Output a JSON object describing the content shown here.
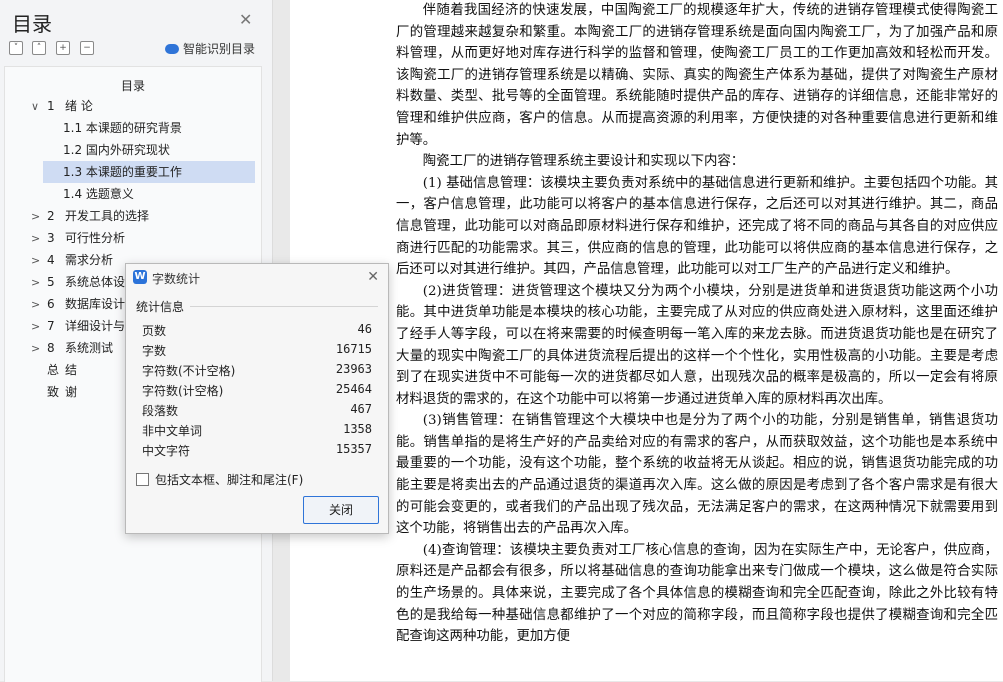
{
  "toc": {
    "title": "目录",
    "heading": "目录",
    "smart_label": "智能识别目录",
    "tool_icons": [
      "collapse-all-icon",
      "expand-all-icon",
      "add-icon",
      "remove-icon"
    ],
    "items": [
      {
        "arrow": "∨",
        "num": "1",
        "text": "绪  论",
        "level": 0
      },
      {
        "arrow": "",
        "num": "",
        "text": "1.1 本课题的研究背景",
        "level": 1
      },
      {
        "arrow": "",
        "num": "",
        "text": "1.2 国内外研究现状",
        "level": 1
      },
      {
        "arrow": "",
        "num": "",
        "text": "1.3 本课题的重要工作",
        "level": 1,
        "active": true
      },
      {
        "arrow": "",
        "num": "",
        "text": "1.4 选题意义",
        "level": 1
      },
      {
        "arrow": ">",
        "num": "2",
        "text": "开发工具的选择",
        "level": 0
      },
      {
        "arrow": ">",
        "num": "3",
        "text": "可行性分析",
        "level": 0
      },
      {
        "arrow": ">",
        "num": "4",
        "text": "需求分析",
        "level": 0
      },
      {
        "arrow": ">",
        "num": "5",
        "text": "系统总体设",
        "level": 0
      },
      {
        "arrow": ">",
        "num": "6",
        "text": "数据库设计",
        "level": 0
      },
      {
        "arrow": ">",
        "num": "7",
        "text": "详细设计与",
        "level": 0
      },
      {
        "arrow": ">",
        "num": "8",
        "text": "系统测试",
        "level": 0
      },
      {
        "arrow": "",
        "num": "总",
        "text": "结",
        "level": 0
      },
      {
        "arrow": "",
        "num": "致",
        "text": "谢",
        "level": 0
      }
    ]
  },
  "dialog": {
    "title": "字数统计",
    "group_label": "统计信息",
    "stats": [
      {
        "label": "页数",
        "value": "46"
      },
      {
        "label": "字数",
        "value": "16715"
      },
      {
        "label": "字符数(不计空格)",
        "value": "23963"
      },
      {
        "label": "字符数(计空格)",
        "value": "25464"
      },
      {
        "label": "段落数",
        "value": "467"
      },
      {
        "label": "非中文单词",
        "value": "1358"
      },
      {
        "label": "中文字符",
        "value": "15357"
      }
    ],
    "checkbox_label": "包括文本框、脚注和尾注(F)",
    "checkbox_checked": false,
    "close_button": "关闭"
  },
  "document": {
    "paragraphs": [
      "伴随着我国经济的快速发展，中国陶瓷工厂的规模逐年扩大，传统的进销存管理模式使得陶瓷工厂的管理越来越复杂和繁重。本陶瓷工厂的进销存管理系统是面向国内陶瓷工厂，为了加强产品和原料管理，从而更好地对库存进行科学的监督和管理，使陶瓷工厂员工的工作更加高效和轻松而开发。该陶瓷工厂的进销存管理系统是以精确、实际、真实的陶瓷生产体系为基础，提供了对陶瓷生产原材料数量、类型、批号等的全面管理。系统能随时提供产品的库存、进销存的详细信息，还能非常好的管理和维护供应商，客户的信息。从而提高资源的利用率，方便快捷的对各种重要信息进行更新和维护等。",
      "陶瓷工厂的进销存管理系统主要设计和实现以下内容：",
      "(1) 基础信息管理：该模块主要负责对系统中的基础信息进行更新和维护。主要包括四个功能。其一，客户信息管理，此功能可以将客户的基本信息进行保存，之后还可以对其进行维护。其二，商品信息管理，此功能可以对商品即原材料进行保存和维护，还完成了将不同的商品与其各自的对应供应商进行匹配的功能需求。其三，供应商的信息的管理，此功能可以将供应商的基本信息进行保存，之后还可以对其进行维护。其四，产品信息管理，此功能可以对工厂生产的产品进行定义和维护。",
      "(2)进货管理：进货管理这个模块又分为两个小模块，分别是进货单和进货退货功能这两个小功能。其中进货单功能是本模块的核心功能，主要完成了从对应的供应商处进入原材料，这里面还维护了经手人等字段，可以在将来需要的时候查明每一笔入库的来龙去脉。而进货退货功能也是在研究了大量的现实中陶瓷工厂的具体进货流程后提出的这样一个个性化，实用性极高的小功能。主要是考虑到了在现实进货中不可能每一次的进货都尽如人意，出现残次品的概率是极高的，所以一定会有将原材料退货的需求的，在这个功能中可以将第一步通过进货单入库的原材料再次出库。",
      "(3)销售管理：在销售管理这个大模块中也是分为了两个小的功能，分别是销售单，销售退货功能。销售单指的是将生产好的产品卖给对应的有需求的客户，从而获取效益，这个功能也是本系统中最重要的一个功能，没有这个功能，整个系统的收益将无从谈起。相应的说，销售退货功能完成的功能主要是将卖出去的产品通过退货的渠道再次入库。这么做的原因是考虑到了各个客户需求是有很大的可能会变更的，或者我们的产品出现了残次品，无法满足客户的需求，在这两种情况下就需要用到这个功能，将销售出去的产品再次入库。",
      "(4)查询管理：该模块主要负责对工厂核心信息的查询，因为在实际生产中，无论客户，供应商，原料还是产品都会有很多，所以将基础信息的查询功能拿出来专门做成一个模块，这么做是符合实际的生产场景的。具体来说，主要完成了各个具体信息的模糊查询和完全匹配查询，除此之外比较有特色的是我给每一种基础信息都维护了一个对应的简称字段，而且简称字段也提供了模糊查询和完全匹配查询这两种功能，更加方便"
    ]
  }
}
